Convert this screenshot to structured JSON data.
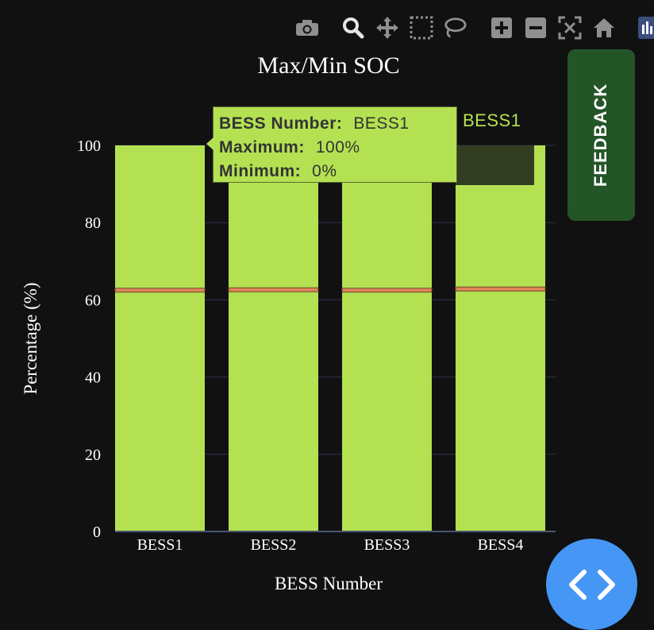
{
  "modebar": {
    "icons": [
      "camera-icon",
      "zoom-icon",
      "pan-icon",
      "box-select-icon",
      "lasso-select-icon",
      "zoom-in-icon",
      "zoom-out-icon",
      "autoscale-icon",
      "reset-axes-icon",
      "plotly-logo-icon"
    ]
  },
  "feedback": {
    "label": "FEEDBACK"
  },
  "tooltip": {
    "rows": [
      {
        "key": "BESS Number:",
        "value": "BESS1"
      },
      {
        "key": "Maximum:",
        "value": "100%"
      },
      {
        "key": "Minimum:",
        "value": "0%"
      }
    ],
    "trace_name": "BESS1"
  },
  "colors": {
    "background": "#111112",
    "bar": "#b3e152",
    "mean_line": "#e0855a",
    "grid": "#2b3446",
    "text": "#ffffff",
    "feedback": "#245527",
    "fab": "#4596f5"
  },
  "chart_data": {
    "type": "bar",
    "title": "Max/Min SOC",
    "xlabel": "BESS Number",
    "ylabel": "Percentage (%)",
    "categories": [
      "BESS1",
      "BESS2",
      "BESS3",
      "BESS4"
    ],
    "series": [
      {
        "name": "Maximum",
        "values": [
          100,
          100,
          100,
          100
        ]
      },
      {
        "name": "Minimum",
        "values": [
          0,
          0,
          0,
          0
        ]
      }
    ],
    "mean_markers": [
      62.5,
      62.6,
      62.5,
      62.8
    ],
    "ylim": [
      0,
      100
    ],
    "yticks": [
      0,
      20,
      40,
      60,
      80,
      100
    ],
    "grid": true,
    "hover_highlight": "BESS4"
  }
}
